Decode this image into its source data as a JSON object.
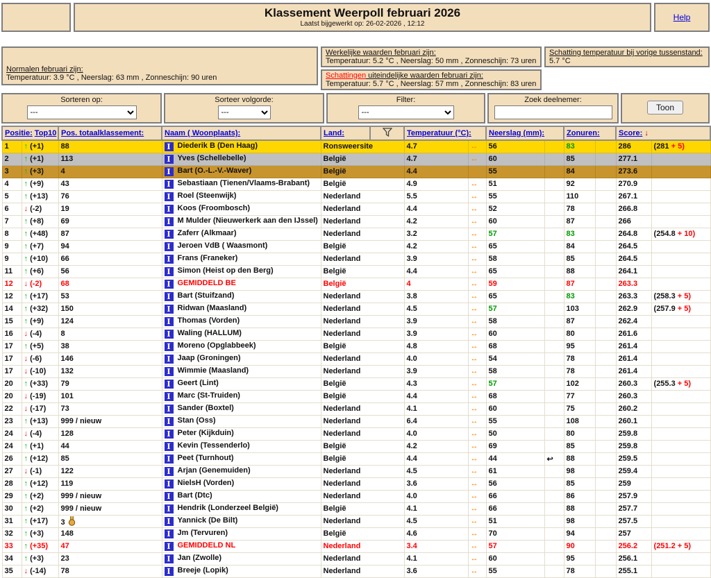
{
  "header": {
    "title": "Klassement Weerpoll februari 2026",
    "subtitle": "Laatst bijgewerkt op: 26-02-2026 , 12:12",
    "help_label": "Help"
  },
  "info": {
    "normalen": {
      "label": "Normalen februari zijn:",
      "text": "Temperatuur: 3.9 °C , Neerslag: 63 mm , Zonneschijn: 90 uren"
    },
    "werkelijke": {
      "label": "Werkelijke waarden februari zijn:",
      "text": "Temperatuur: 5.2 °C , Neerslag: 50 mm , Zonneschijn: 73 uren"
    },
    "schattingen": {
      "label_red": "Schattingen",
      "label_rest": " uiteindelijke waarden februari zijn:",
      "text": "Temperatuur: 5.7 °C , Neerslag: 57 mm , Zonneschijn: 83 uren"
    },
    "tussenstand": {
      "label": "Schatting temperatuur bij vorige tussenstand:",
      "value": "5.7 °C"
    }
  },
  "controls": {
    "sorteren_label": "Sorteren op:",
    "sorteren_value": "---",
    "volgorde_label": "Sorteer volgorde:",
    "volgorde_value": "---",
    "filter_label": "Filter:",
    "filter_value": "---",
    "zoek_label": "Zoek deelnemer:",
    "zoek_value": "",
    "toon_label": "Toon"
  },
  "icons": {
    "up": "↑",
    "down": "↓",
    "both": "↔",
    "return": "↩",
    "score_sort": "↓",
    "participant": "I"
  },
  "colors": {
    "row_gold": "#FFD700",
    "row_silver": "#C0C0C0",
    "row_bronze": "#C8942E",
    "avg_red": "#FF0000",
    "match_green": "#009900",
    "arrow_orange": "#FF8000",
    "link_blue": "#0000DD",
    "panel_tan": "#F3DEBC"
  },
  "table": {
    "headers": {
      "positie": "Positie:",
      "top10": "Top10",
      "pos_totaal": "Pos. totaalklassement:",
      "naam": "Naam ( Woonplaats):",
      "land": "Land:",
      "temperatuur": "Temperatuur (°C):",
      "neerslag": "Neerslag (mm):",
      "zonuren": "Zonuren:",
      "score": "Score:",
      "score_sort_arrow": "↓"
    },
    "rows": [
      {
        "pos": "1",
        "dir": "up",
        "delta": "(+1)",
        "pos_totaal": "88",
        "naam": "Diederik B (Den Haag)",
        "land": "Ronsweersite",
        "temp": "4.7",
        "neerslag": "56",
        "zonuren": "83",
        "zonuren_green": true,
        "score": "286",
        "bonus_base": "(281 ",
        "bonus_plus": "+ 5)",
        "style": "gold"
      },
      {
        "pos": "2",
        "dir": "up",
        "delta": "(+1)",
        "pos_totaal": "113",
        "naam": "Yves (Schellebelle)",
        "land": "België",
        "temp": "4.7",
        "neerslag": "60",
        "zonuren": "85",
        "score": "277.1",
        "style": "silver"
      },
      {
        "pos": "3",
        "dir": "up",
        "delta": "(+3)",
        "pos_totaal": "4",
        "naam": "Bart (O.-L.-V.-Waver)",
        "land": "België",
        "temp": "4.4",
        "neerslag": "55",
        "zonuren": "84",
        "score": "273.6",
        "style": "bronze"
      },
      {
        "pos": "4",
        "dir": "up",
        "delta": "(+9)",
        "pos_totaal": "43",
        "naam": "Sebastiaan (Tienen/Vlaams-Brabant)",
        "land": "België",
        "temp": "4.9",
        "neerslag": "51",
        "zonuren": "92",
        "score": "270.9"
      },
      {
        "pos": "5",
        "dir": "up",
        "delta": "(+13)",
        "pos_totaal": "76",
        "naam": "Roel (Steenwijk)",
        "land": "Nederland",
        "temp": "5.5",
        "neerslag": "55",
        "zonuren": "110",
        "score": "267.1"
      },
      {
        "pos": "6",
        "dir": "down",
        "delta": "(-2)",
        "pos_totaal": "19",
        "naam": "Koos (Froombosch)",
        "land": "Nederland",
        "temp": "4.4",
        "neerslag": "52",
        "zonuren": "78",
        "score": "266.8"
      },
      {
        "pos": "7",
        "dir": "up",
        "delta": "(+8)",
        "pos_totaal": "69",
        "naam": "M Mulder (Nieuwerkerk aan den IJssel)",
        "land": "Nederland",
        "temp": "4.2",
        "neerslag": "60",
        "zonuren": "87",
        "score": "266"
      },
      {
        "pos": "8",
        "dir": "up",
        "delta": "(+48)",
        "pos_totaal": "87",
        "naam": "Zaferr (Alkmaar)",
        "land": "Nederland",
        "temp": "3.2",
        "neerslag": "57",
        "neerslag_green": true,
        "zonuren": "83",
        "zonuren_green": true,
        "score": "264.8",
        "bonus_base": "(254.8 ",
        "bonus_plus": "+ 10)"
      },
      {
        "pos": "9",
        "dir": "up",
        "delta": "(+7)",
        "pos_totaal": "94",
        "naam": "Jeroen VdB ( Waasmont)",
        "land": "België",
        "temp": "4.2",
        "neerslag": "65",
        "zonuren": "84",
        "score": "264.5"
      },
      {
        "pos": "9",
        "dir": "up",
        "delta": "(+10)",
        "pos_totaal": "66",
        "naam": "Frans (Franeker)",
        "land": "Nederland",
        "temp": "3.9",
        "neerslag": "58",
        "zonuren": "85",
        "score": "264.5"
      },
      {
        "pos": "11",
        "dir": "up",
        "delta": "(+6)",
        "pos_totaal": "56",
        "naam": "Simon (Heist op den Berg)",
        "land": "België",
        "temp": "4.4",
        "neerslag": "65",
        "zonuren": "88",
        "score": "264.1"
      },
      {
        "pos": "12",
        "dir": "down",
        "delta": "(-2)",
        "pos_totaal": "68",
        "naam": "GEMIDDELD BE",
        "land": "België",
        "temp": "4",
        "neerslag": "59",
        "zonuren": "87",
        "score": "263.3",
        "style": "avg"
      },
      {
        "pos": "12",
        "dir": "up",
        "delta": "(+17)",
        "pos_totaal": "53",
        "naam": "Bart (Stuifzand)",
        "land": "Nederland",
        "temp": "3.8",
        "neerslag": "65",
        "zonuren": "83",
        "zonuren_green": true,
        "score": "263.3",
        "bonus_base": "(258.3 ",
        "bonus_plus": "+ 5)"
      },
      {
        "pos": "14",
        "dir": "up",
        "delta": "(+32)",
        "pos_totaal": "150",
        "naam": "Ridwan (Maasland)",
        "land": "Nederland",
        "temp": "4.5",
        "neerslag": "57",
        "neerslag_green": true,
        "zonuren": "103",
        "score": "262.9",
        "bonus_base": "(257.9 ",
        "bonus_plus": "+ 5)"
      },
      {
        "pos": "15",
        "dir": "up",
        "delta": "(+9)",
        "pos_totaal": "124",
        "naam": "Thomas (Vorden)",
        "land": "Nederland",
        "temp": "3.9",
        "neerslag": "58",
        "zonuren": "87",
        "score": "262.4"
      },
      {
        "pos": "16",
        "dir": "down",
        "delta": "(-4)",
        "pos_totaal": "8",
        "naam": "Waling (HALLUM)",
        "land": "Nederland",
        "temp": "3.9",
        "neerslag": "60",
        "zonuren": "80",
        "score": "261.6"
      },
      {
        "pos": "17",
        "dir": "up",
        "delta": "(+5)",
        "pos_totaal": "38",
        "naam": "Moreno (Opglabbeek)",
        "land": "België",
        "temp": "4.8",
        "neerslag": "68",
        "zonuren": "95",
        "score": "261.4"
      },
      {
        "pos": "17",
        "dir": "down",
        "delta": "(-6)",
        "pos_totaal": "146",
        "naam": "Jaap (Groningen)",
        "land": "Nederland",
        "temp": "4.0",
        "neerslag": "54",
        "zonuren": "78",
        "score": "261.4"
      },
      {
        "pos": "17",
        "dir": "down",
        "delta": "(-10)",
        "pos_totaal": "132",
        "naam": "Wimmie (Maasland)",
        "land": "Nederland",
        "temp": "3.9",
        "neerslag": "58",
        "zonuren": "78",
        "score": "261.4"
      },
      {
        "pos": "20",
        "dir": "up",
        "delta": "(+33)",
        "pos_totaal": "79",
        "naam": "Geert (Lint)",
        "land": "België",
        "temp": "4.3",
        "neerslag": "57",
        "neerslag_green": true,
        "zonuren": "102",
        "score": "260.3",
        "bonus_base": "(255.3 ",
        "bonus_plus": "+ 5)"
      },
      {
        "pos": "20",
        "dir": "down",
        "delta": "(-19)",
        "pos_totaal": "101",
        "naam": "Marc (St-Truiden)",
        "land": "België",
        "temp": "4.4",
        "neerslag": "68",
        "zonuren": "77",
        "score": "260.3"
      },
      {
        "pos": "22",
        "dir": "down",
        "delta": "(-17)",
        "pos_totaal": "73",
        "naam": "Sander (Boxtel)",
        "land": "Nederland",
        "temp": "4.1",
        "neerslag": "60",
        "zonuren": "75",
        "score": "260.2"
      },
      {
        "pos": "23",
        "dir": "up",
        "delta": "(+13)",
        "pos_totaal": "999 / nieuw",
        "naam": "Stan (Oss)",
        "land": "Nederland",
        "temp": "6.4",
        "neerslag": "55",
        "zonuren": "108",
        "score": "260.1"
      },
      {
        "pos": "24",
        "dir": "down",
        "delta": "(-4)",
        "pos_totaal": "128",
        "naam": "Peter (Kijkduin)",
        "land": "Nederland",
        "temp": "4.0",
        "neerslag": "50",
        "zonuren": "80",
        "score": "259.8"
      },
      {
        "pos": "24",
        "dir": "up",
        "delta": "(+1)",
        "pos_totaal": "44",
        "naam": "Kevin (Tessenderlo)",
        "land": "België",
        "temp": "4.2",
        "neerslag": "69",
        "zonuren": "85",
        "score": "259.8"
      },
      {
        "pos": "26",
        "dir": "up",
        "delta": "(+12)",
        "pos_totaal": "85",
        "naam": "Peet (Turnhout)",
        "land": "België",
        "temp": "4.4",
        "neerslag": "44",
        "return_icon": true,
        "zonuren": "88",
        "score": "259.5"
      },
      {
        "pos": "27",
        "dir": "down",
        "delta": "(-1)",
        "pos_totaal": "122",
        "naam": "Arjan (Genemuiden)",
        "land": "Nederland",
        "temp": "4.5",
        "neerslag": "61",
        "zonuren": "98",
        "score": "259.4"
      },
      {
        "pos": "28",
        "dir": "up",
        "delta": "(+12)",
        "pos_totaal": "119",
        "naam": "NielsH (Vorden)",
        "land": "Nederland",
        "temp": "3.6",
        "neerslag": "56",
        "zonuren": "85",
        "score": "259"
      },
      {
        "pos": "29",
        "dir": "up",
        "delta": "(+2)",
        "pos_totaal": "999 / nieuw",
        "naam": "Bart (Dtc)",
        "land": "Nederland",
        "temp": "4.0",
        "neerslag": "66",
        "zonuren": "86",
        "score": "257.9"
      },
      {
        "pos": "30",
        "dir": "up",
        "delta": "(+2)",
        "pos_totaal": "999 / nieuw",
        "naam": "Hendrik (Londerzeel België)",
        "land": "België",
        "temp": "4.1",
        "neerslag": "66",
        "zonuren": "88",
        "score": "257.7"
      },
      {
        "pos": "31",
        "dir": "up",
        "delta": "(+17)",
        "pos_totaal": "3",
        "medal": true,
        "naam": "Yannick (De Bilt)",
        "land": "Nederland",
        "temp": "4.5",
        "neerslag": "51",
        "zonuren": "98",
        "score": "257.5"
      },
      {
        "pos": "32",
        "dir": "up",
        "delta": "(+3)",
        "pos_totaal": "148",
        "naam": "Jm (Tervuren)",
        "land": "België",
        "temp": "4.6",
        "neerslag": "70",
        "zonuren": "94",
        "score": "257"
      },
      {
        "pos": "33",
        "dir": "up",
        "delta": "(+35)",
        "pos_totaal": "47",
        "naam": "GEMIDDELD NL",
        "land": "Nederland",
        "temp": "3.4",
        "neerslag": "57",
        "zonuren": "90",
        "score": "256.2",
        "bonus_base": "(251.2 ",
        "bonus_plus": "+ 5)",
        "style": "avg"
      },
      {
        "pos": "34",
        "dir": "up",
        "delta": "(+3)",
        "pos_totaal": "23",
        "naam": "Jan (Zwolle)",
        "land": "Nederland",
        "temp": "4.1",
        "neerslag": "60",
        "zonuren": "95",
        "score": "256.1"
      },
      {
        "pos": "35",
        "dir": "down",
        "delta": "(-14)",
        "pos_totaal": "78",
        "naam": "Breeje (Lopik)",
        "land": "Nederland",
        "temp": "3.6",
        "neerslag": "55",
        "zonuren": "78",
        "score": "255.1"
      }
    ]
  }
}
